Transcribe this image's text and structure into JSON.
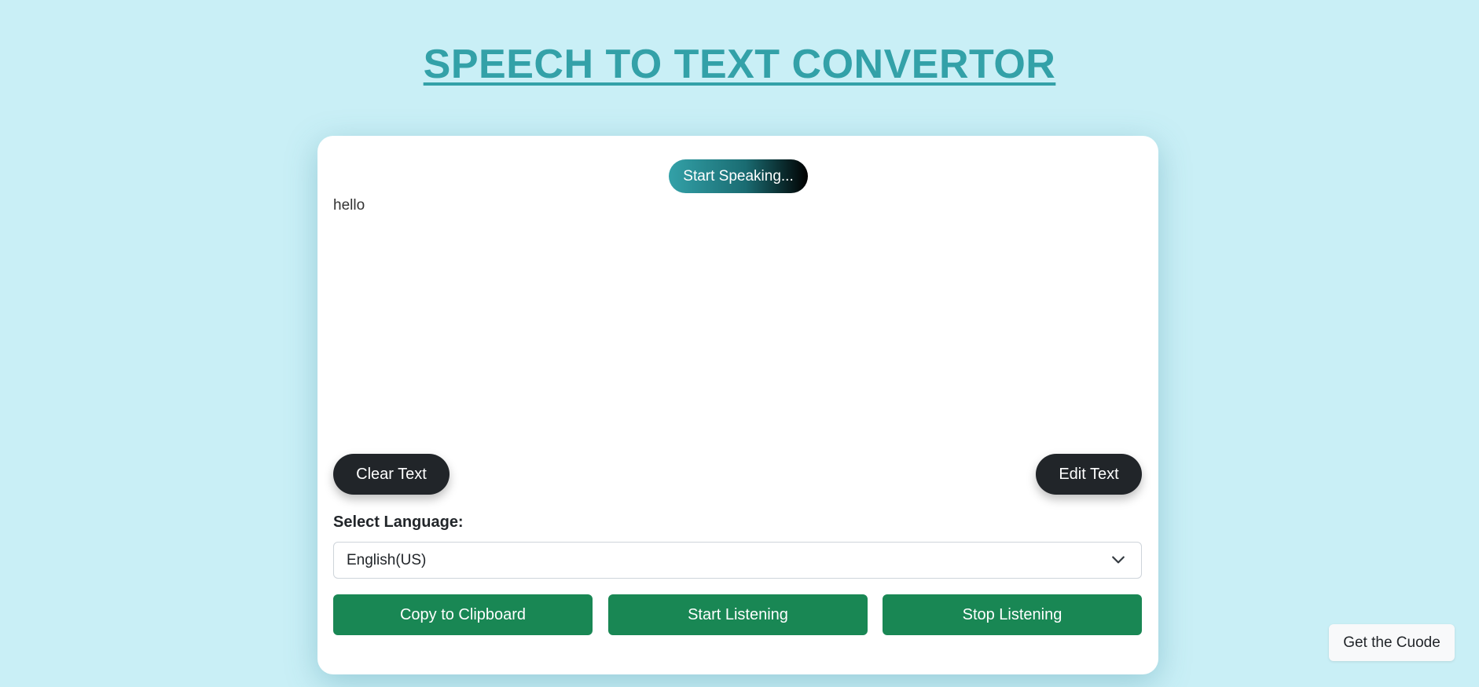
{
  "header": {
    "title": "SPEECH TO TEXT CONVERTOR"
  },
  "card": {
    "speak_button_label": "Start Speaking...",
    "transcript_text": "hello",
    "clear_button_label": "Clear Text",
    "edit_button_label": "Edit Text",
    "language_label": "Select Language:",
    "language_selected": "English(US)",
    "copy_button_label": "Copy to Clipboard",
    "start_button_label": "Start Listening",
    "stop_button_label": "Stop Listening"
  },
  "footer": {
    "code_button_label": "Get the Cuode"
  },
  "colors": {
    "background": "#c9eff6",
    "title": "#33a1a8",
    "dark_button": "#212529",
    "green_button": "#198754",
    "card": "#ffffff"
  },
  "icons": {
    "select_arrow": "chevron-down-icon"
  }
}
